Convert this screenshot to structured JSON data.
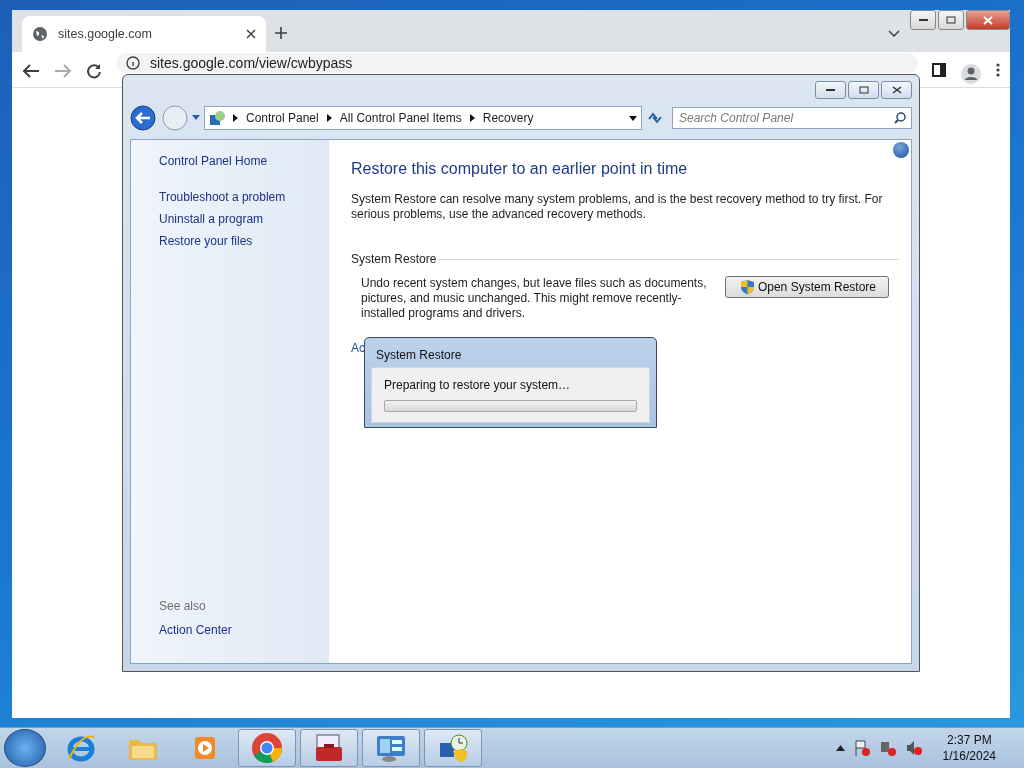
{
  "browser": {
    "tab_title": "sites.google.com",
    "address": "sites.google.com/view/cwbypass"
  },
  "explorer": {
    "breadcrumb": [
      "Control Panel",
      "All Control Panel Items",
      "Recovery"
    ],
    "search": {
      "placeholder": "Search Control Panel"
    },
    "sidebar": {
      "home": "Control Panel Home",
      "tasks": [
        "Troubleshoot a problem",
        "Uninstall a program",
        "Restore your files"
      ],
      "see_also_heading": "See also",
      "see_also": [
        "Action Center"
      ]
    },
    "heading": "Restore this computer to an earlier point in time",
    "intro": "System Restore can resolve many system problems, and is the best recovery method to try first. For serious problems, use the advanced recovery methods.",
    "section": {
      "title": "System Restore",
      "text": "Undo recent system changes, but leave files such as documents, pictures, and music unchanged. This might remove recently-installed programs and drivers.",
      "button": "Open System Restore"
    },
    "partial_link": "Ac"
  },
  "dialog": {
    "title": "System Restore",
    "message": "Preparing to restore your system…",
    "progress": {
      "level": 0
    }
  },
  "taskbar": {
    "apps": [
      {
        "kind": "ie",
        "running": false
      },
      {
        "kind": "folder",
        "running": false
      },
      {
        "kind": "media",
        "running": false
      },
      {
        "kind": "chrome",
        "running": true
      },
      {
        "kind": "toolbox",
        "running": true
      },
      {
        "kind": "panel",
        "running": true
      },
      {
        "kind": "restore",
        "running": true
      }
    ],
    "clock": {
      "time": "2:37 PM",
      "date": "1/16/2024"
    }
  }
}
